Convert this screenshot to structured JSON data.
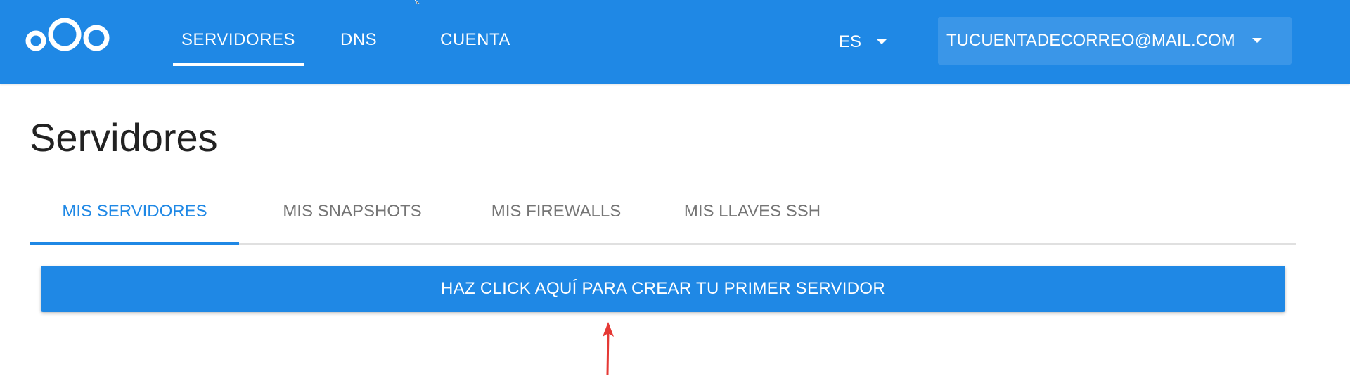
{
  "header": {
    "logo_icon": "cloud-rings-logo",
    "nav": [
      {
        "label": "SERVIDORES",
        "active": true
      },
      {
        "label": "DNS",
        "active": false
      },
      {
        "label": "CUENTA",
        "active": false
      }
    ],
    "language": "ES",
    "account_email": "TUCUENTADECORREO@MAIL.COM",
    "colors": {
      "bar": "#1f88e5",
      "account_bg": "#3a96e8",
      "text": "#ffffff"
    }
  },
  "page": {
    "title": "Servidores"
  },
  "tabs": [
    {
      "label": "MIS SERVIDORES",
      "active": true
    },
    {
      "label": "MIS SNAPSHOTS",
      "active": false
    },
    {
      "label": "MIS FIREWALLS",
      "active": false
    },
    {
      "label": "MIS LLAVES SSH",
      "active": false
    }
  ],
  "create_button": {
    "label": "HAZ CLICK AQUÍ PARA CREAR TU PRIMER SERVIDOR"
  },
  "annotation": {
    "icon": "red-arrow-up-icon",
    "color": "#e53935"
  }
}
